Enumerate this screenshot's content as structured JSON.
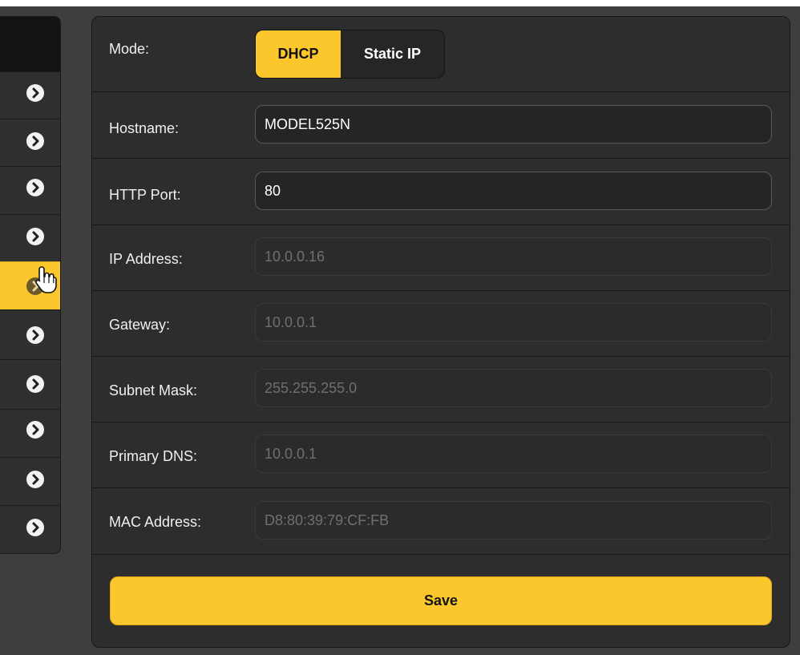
{
  "settings": {
    "mode": {
      "label": "Mode:",
      "options": [
        "DHCP",
        "Static IP"
      ],
      "selected": "DHCP"
    },
    "hostname": {
      "label": "Hostname:",
      "value": "MODEL525N"
    },
    "http_port": {
      "label": "HTTP Port:",
      "value": "80"
    },
    "ip_address": {
      "label": "IP Address:",
      "value": "10.0.0.16"
    },
    "gateway": {
      "label": "Gateway:",
      "value": "10.0.0.1"
    },
    "subnet_mask": {
      "label": "Subnet Mask:",
      "value": "255.255.255.0"
    },
    "primary_dns": {
      "label": "Primary DNS:",
      "value": "10.0.0.1"
    },
    "mac_address": {
      "label": "MAC Address:",
      "value": "D8:80:39:79:CF:FB"
    }
  },
  "save_label": "Save",
  "sidebar": {
    "item_icon": "chevron-right-icon",
    "item_count": 10,
    "active_index": 4
  },
  "colors": {
    "accent": "#fcc72c",
    "panel": "#2d2d2d",
    "background": "#3e3e3e"
  }
}
